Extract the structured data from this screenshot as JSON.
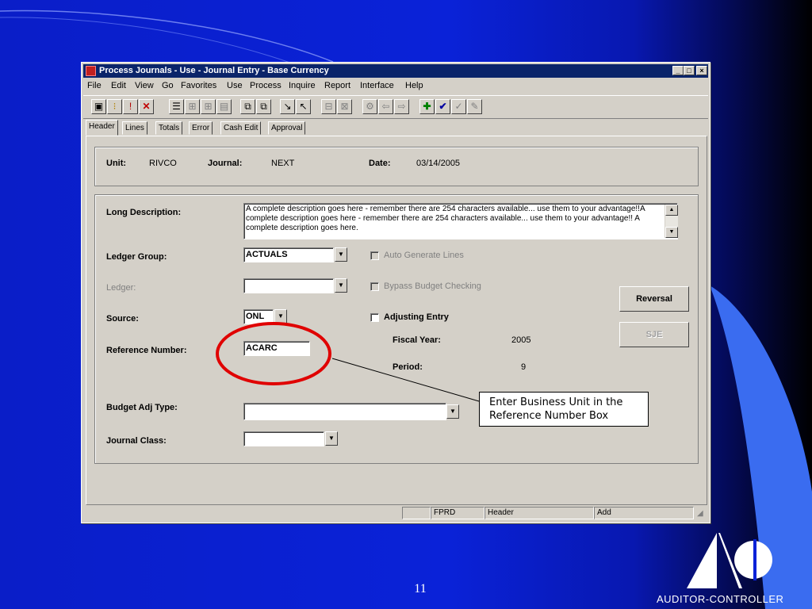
{
  "window": {
    "title": "Process Journals - Use - Journal Entry - Base Currency",
    "controls": [
      "_",
      "□",
      "×"
    ]
  },
  "menu": [
    "File",
    "Edit",
    "View",
    "Go",
    "Favorites",
    "Use",
    "Process",
    "Inquire",
    "Report",
    "Interface",
    "Help"
  ],
  "toolbar_icons": [
    "save-icon",
    "traffic-light-icon",
    "traffic-light-alert-icon",
    "delete-x-icon",
    "list-icon",
    "insert-row-icon",
    "insert-row-2-icon",
    "delete-row-icon",
    "copy-icon",
    "paste-icon",
    "next-icon",
    "previous-icon",
    "calc-icon",
    "grid-icon",
    "settings-icon",
    "back-arrow-icon",
    "forward-arrow-icon",
    "add-plus-icon",
    "check-icon",
    "check-partial-icon",
    "edit-icon"
  ],
  "tabs": [
    "Header",
    "Lines",
    "Totals",
    "Error",
    "Cash Edit",
    "Approval"
  ],
  "header": {
    "unit_label": "Unit:",
    "unit_value": "RIVCO",
    "journal_label": "Journal:",
    "journal_value": "NEXT",
    "date_label": "Date:",
    "date_value": "03/14/2005"
  },
  "form": {
    "long_description_label": "Long Description:",
    "long_description_value": "A complete description goes here - remember there are 254 characters available... use them to your advantage!!A complete description goes here - remember there are 254 characters available... use them to your advantage!! A complete description goes here.",
    "ledger_group_label": "Ledger Group:",
    "ledger_group_value": "ACTUALS",
    "ledger_label": "Ledger:",
    "ledger_value": "",
    "source_label": "Source:",
    "source_value": "ONL",
    "reference_number_label": "Reference Number:",
    "reference_number_value": "ACARC",
    "budget_adj_type_label": "Budget Adj Type:",
    "budget_adj_type_value": "",
    "journal_class_label": "Journal Class:",
    "journal_class_value": "",
    "auto_generate_lines_label": "Auto Generate Lines",
    "bypass_budget_checking_label": "Bypass Budget Checking",
    "adjusting_entry_label": "Adjusting Entry",
    "fiscal_year_label": "Fiscal Year:",
    "fiscal_year_value": "2005",
    "period_label": "Period:",
    "period_value": "9",
    "reversal_button": "Reversal",
    "sje_button": "SJE"
  },
  "statusbar": [
    "",
    "FPRD",
    "Header",
    "Add"
  ],
  "callout": "Enter Business Unit in the Reference Number Box",
  "slide": {
    "page_number": "11",
    "logo_text": "AUDITOR-CONTROLLER"
  },
  "colors": {
    "titlebar": "#0a246a",
    "highlight_circle": "#e00000",
    "background": "#0a1ec8"
  }
}
